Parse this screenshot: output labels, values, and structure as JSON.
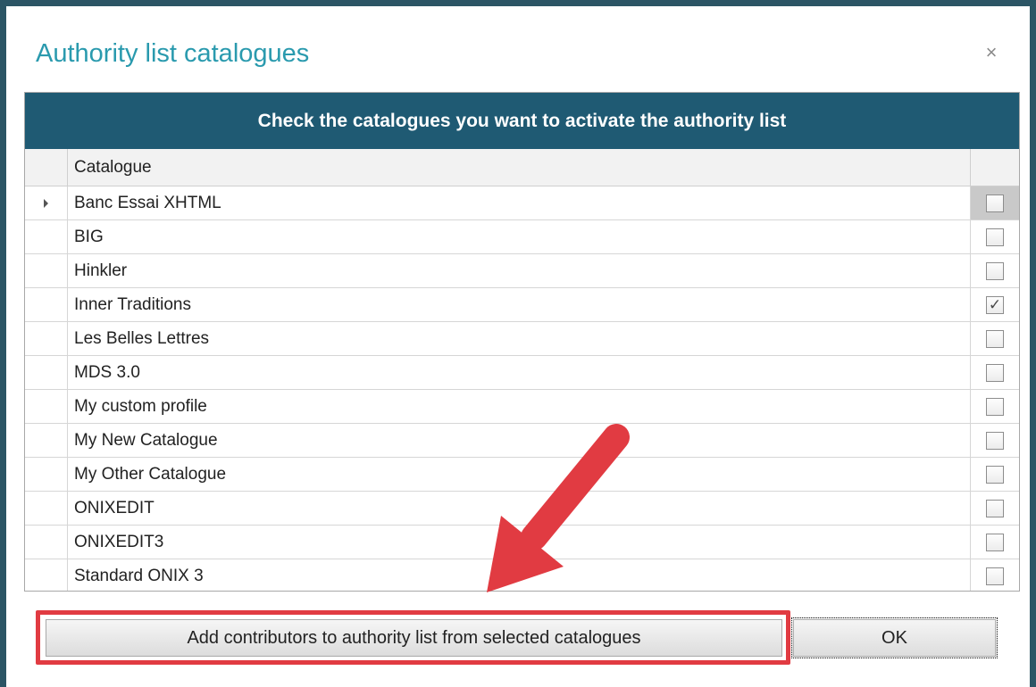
{
  "dialog": {
    "title": "Authority list catalogues",
    "close_glyph": "×"
  },
  "grid": {
    "banner": "Check the catalogues you want to activate the authority list",
    "column_header": "Catalogue",
    "rows": [
      {
        "name": "Banc Essai XHTML",
        "checked": false,
        "current": true
      },
      {
        "name": "BIG",
        "checked": false
      },
      {
        "name": "Hinkler",
        "checked": false
      },
      {
        "name": "Inner Traditions",
        "checked": true
      },
      {
        "name": "Les Belles Lettres",
        "checked": false
      },
      {
        "name": "MDS 3.0",
        "checked": false
      },
      {
        "name": "My custom profile",
        "checked": false
      },
      {
        "name": "My New Catalogue",
        "checked": false
      },
      {
        "name": "My Other Catalogue",
        "checked": false
      },
      {
        "name": "ONIXEDIT",
        "checked": false
      },
      {
        "name": "ONIXEDIT3",
        "checked": false
      },
      {
        "name": "Standard ONIX 3",
        "checked": false
      }
    ]
  },
  "buttons": {
    "add_contributors": "Add contributors to authority list from selected catalogues",
    "ok": "OK"
  },
  "annotation": {
    "color": "#e13b42",
    "type": "arrow-and-box"
  },
  "theme": {
    "title_color": "#2a9aae",
    "banner_color": "#1f5a73",
    "frame_color": "#2c5565"
  }
}
